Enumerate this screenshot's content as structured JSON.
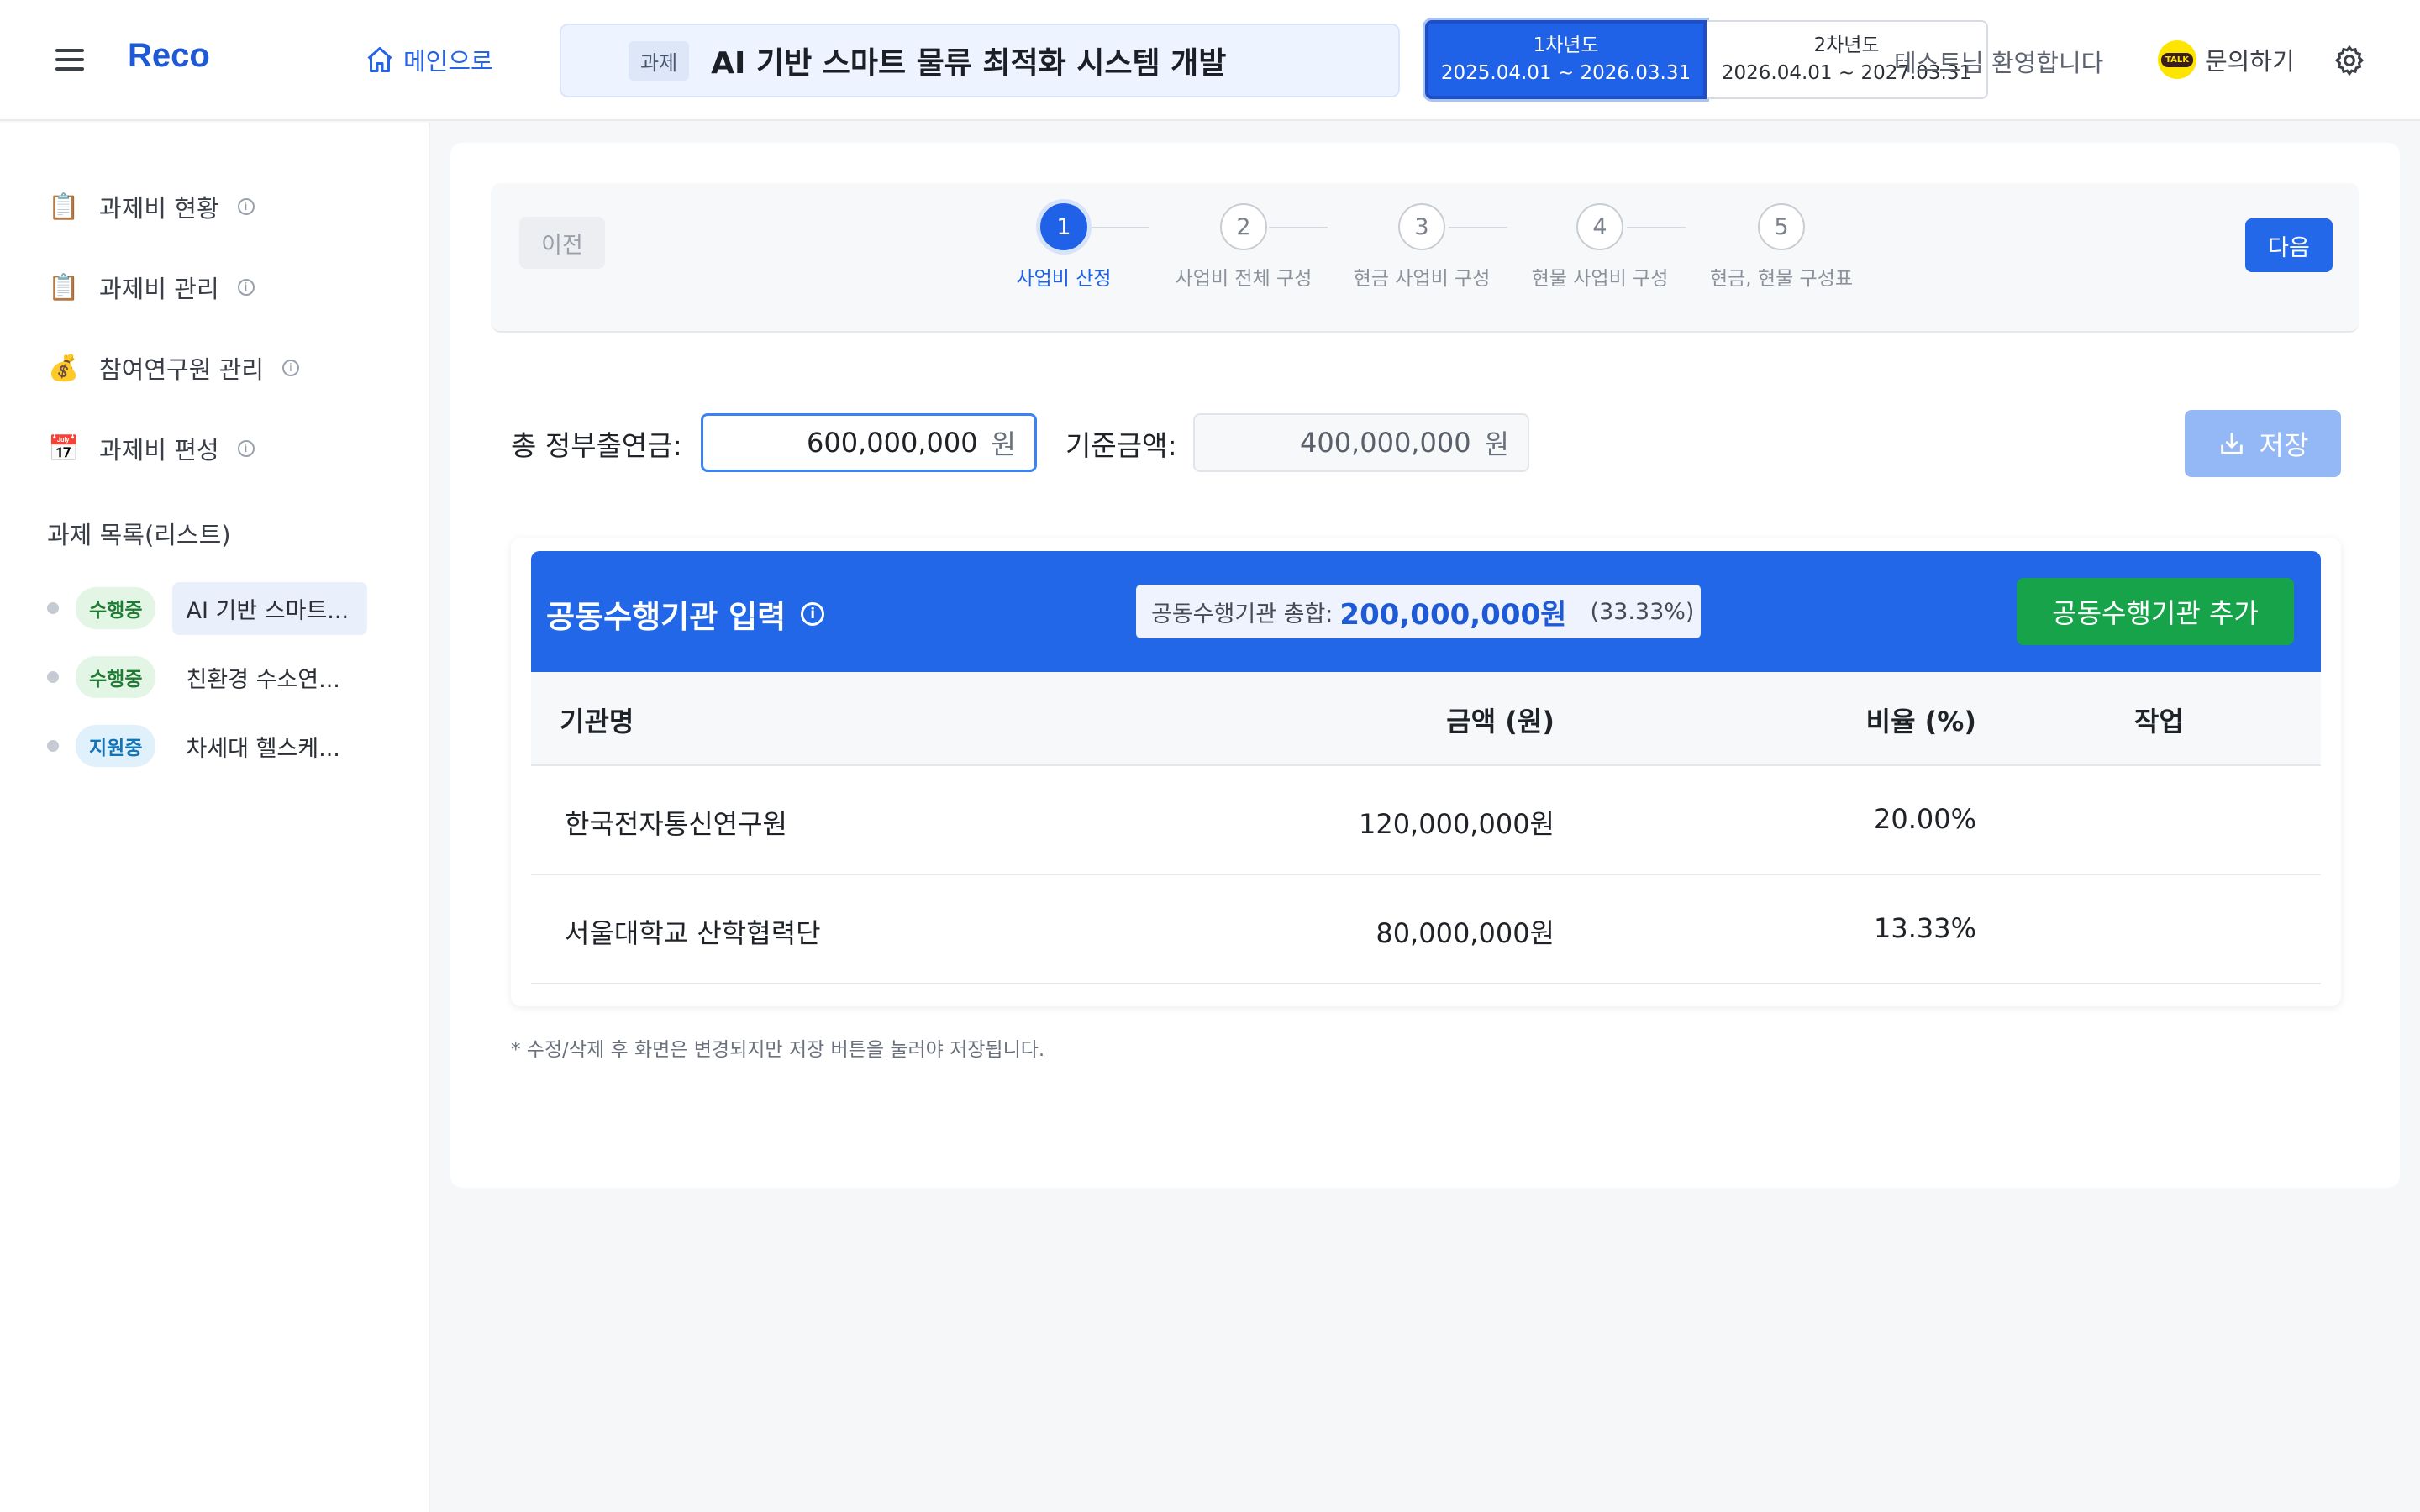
{
  "header": {
    "logo": "Reco",
    "home_label": "메인으로",
    "project_tag": "과제",
    "project_title": "AI 기반 스마트 물류 최적화 시스템 개발",
    "years": [
      {
        "label": "1차년도",
        "period": "2025.04.01 ~ 2026.03.31",
        "active": true
      },
      {
        "label": "2차년도",
        "period": "2026.04.01 ~ 2027.03.31",
        "active": false
      }
    ],
    "welcome": "테스트님 환영합니다",
    "kakao_icon_text": "TALK",
    "contact_label": "문의하기"
  },
  "sidebar": {
    "menu": [
      {
        "emoji": "📋",
        "label": "과제비 현황"
      },
      {
        "emoji": "📋",
        "label": "과제비 관리"
      },
      {
        "emoji": "💰",
        "label": "참여연구원 관리"
      },
      {
        "emoji": "📅",
        "label": "과제비 편성"
      }
    ],
    "section_title": "과제 목록(리스트)",
    "projects": [
      {
        "status": "수행중",
        "name": "AI 기반 스마트...",
        "active": true
      },
      {
        "status": "수행중",
        "name": "친환경 수소연...",
        "active": false
      },
      {
        "status": "지원중",
        "name": "차세대 헬스케...",
        "active": false
      }
    ]
  },
  "stepper": {
    "prev_label": "이전",
    "next_label": "다음",
    "steps": [
      {
        "num": "1",
        "label": "사업비 산정"
      },
      {
        "num": "2",
        "label": "사업비 전체 구성"
      },
      {
        "num": "3",
        "label": "현금 사업비 구성"
      },
      {
        "num": "4",
        "label": "현물 사업비 구성"
      },
      {
        "num": "5",
        "label": "현금, 현물 구성표"
      }
    ],
    "active_step": 1
  },
  "form": {
    "total_label": "총 정부출연금:",
    "total_value": "600,000,000",
    "base_label": "기준금액:",
    "base_value": "400,000,000",
    "unit": "원",
    "save_label": "저장"
  },
  "joint": {
    "title": "공동수행기관 입력",
    "sum_label": "공동수행기관 총합:",
    "sum_value": "200,000,000원",
    "sum_pct": "(33.33%)",
    "add_label": "공동수행기관 추가",
    "columns": [
      "기관명",
      "금액 (원)",
      "비율 (%)",
      "작업"
    ],
    "rows": [
      {
        "name": "한국전자통신연구원",
        "amount": "120,000,000원",
        "ratio": "20.00%"
      },
      {
        "name": "서울대학교 산학협력단",
        "amount": "80,000,000원",
        "ratio": "13.33%"
      }
    ]
  },
  "note": "* 수정/삭제 후 화면은 변경되지만 저장 버튼을 눌러야 저장됩니다.",
  "colors": {
    "primary": "#2167e8",
    "success": "#17a34a",
    "kakao": "#fee500"
  }
}
